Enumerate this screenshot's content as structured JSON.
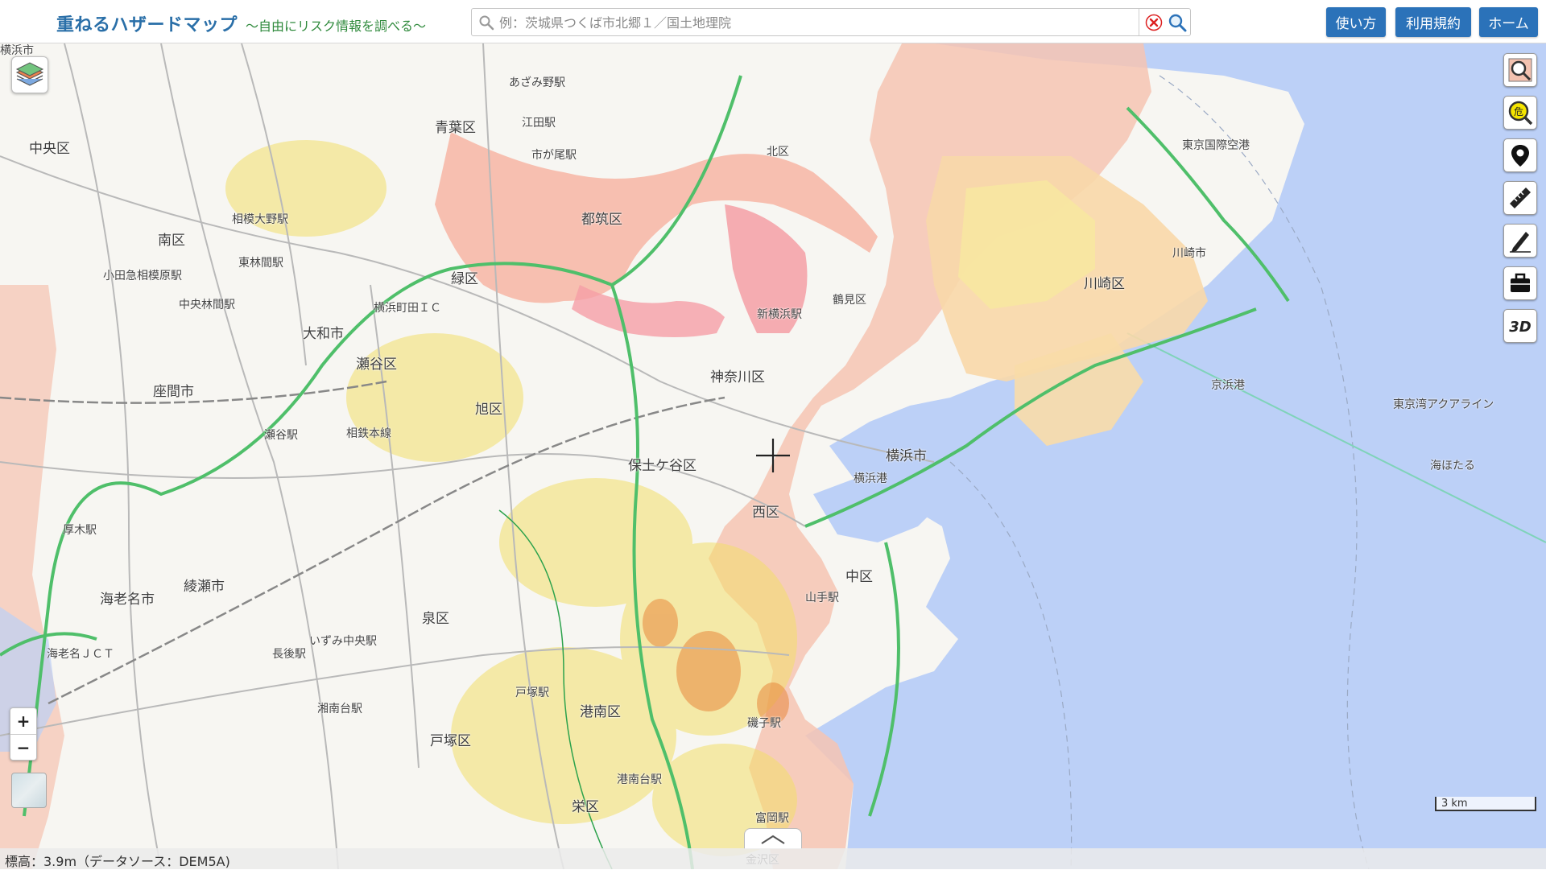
{
  "header": {
    "title": "重ねるハザードマップ",
    "subtitle": "～自由にリスク情報を調べる～",
    "search_placeholder": "例：茨城県つくば市北郷１／国土地理院",
    "buttons": {
      "howto": "使い方",
      "terms": "利用規約",
      "home": "ホーム"
    }
  },
  "map_labels": [
    {
      "text": "横浜市",
      "big": false
    },
    {
      "text": "あざみ野駅",
      "big": false
    },
    {
      "text": "中央区",
      "big": true
    },
    {
      "text": "青葉区",
      "big": true
    },
    {
      "text": "江田駅",
      "big": false
    },
    {
      "text": "市が尾駅",
      "big": false
    },
    {
      "text": "都筑区",
      "big": true
    },
    {
      "text": "北区",
      "big": false
    },
    {
      "text": "南区",
      "big": true
    },
    {
      "text": "東林間駅",
      "big": false
    },
    {
      "text": "緑区",
      "big": true
    },
    {
      "text": "横浜町田ＩＣ",
      "big": false
    },
    {
      "text": "瀬谷区",
      "big": true
    },
    {
      "text": "大和市",
      "big": true
    },
    {
      "text": "神奈川区",
      "big": true
    },
    {
      "text": "旭区",
      "big": true
    },
    {
      "text": "座間市",
      "big": true
    },
    {
      "text": "相模大野駅",
      "big": false
    },
    {
      "text": "小田急相模原駅",
      "big": false
    },
    {
      "text": "鶴見区",
      "big": false
    },
    {
      "text": "川崎区",
      "big": true
    },
    {
      "text": "川崎市",
      "big": false
    },
    {
      "text": "東京国際空港",
      "big": false
    },
    {
      "text": "京浜港",
      "big": false
    },
    {
      "text": "横浜市",
      "big": true
    },
    {
      "text": "横浜港",
      "big": false
    },
    {
      "text": "保土ケ谷区",
      "big": true
    },
    {
      "text": "西区",
      "big": true
    },
    {
      "text": "中区",
      "big": true
    },
    {
      "text": "山手駅",
      "big": false
    },
    {
      "text": "綾瀬市",
      "big": true
    },
    {
      "text": "海老名市",
      "big": true
    },
    {
      "text": "泉区",
      "big": true
    },
    {
      "text": "港南区",
      "big": true
    },
    {
      "text": "戸塚区",
      "big": true
    },
    {
      "text": "栄区",
      "big": true
    },
    {
      "text": "いずみ中央駅",
      "big": false
    },
    {
      "text": "湘南台駅",
      "big": false
    },
    {
      "text": "戸塚駅",
      "big": false
    },
    {
      "text": "港南台駅",
      "big": false
    },
    {
      "text": "磯子駅",
      "big": false
    },
    {
      "text": "富岡駅",
      "big": false
    },
    {
      "text": "厚木駅",
      "big": false
    },
    {
      "text": "海老名ＪＣＴ",
      "big": false
    },
    {
      "text": "長後駅",
      "big": false
    },
    {
      "text": "瀬谷駅",
      "big": false
    },
    {
      "text": "相鉄本線",
      "big": false
    },
    {
      "text": "新横浜駅",
      "big": false
    },
    {
      "text": "東京湾アクアライン",
      "big": false
    },
    {
      "text": "海ほたる",
      "big": false
    },
    {
      "text": "中央林間駅",
      "big": false
    },
    {
      "text": "金沢区",
      "big": false
    }
  ],
  "scale": {
    "label": "3 km"
  },
  "status": {
    "text": "標高：3.9m（データソース：DEM5A)"
  },
  "controls": {
    "zoom_in": "+",
    "zoom_out": "−"
  },
  "colors": {
    "sea": "#bcd0f7",
    "land": "#f7f6f2",
    "flood_pink": "#f6b9a8",
    "flood_light": "#f9d3c3",
    "flood_yellow": "#f7e9a0",
    "road_green": "#4fbf6a",
    "header_blue": "#2b72b9"
  }
}
